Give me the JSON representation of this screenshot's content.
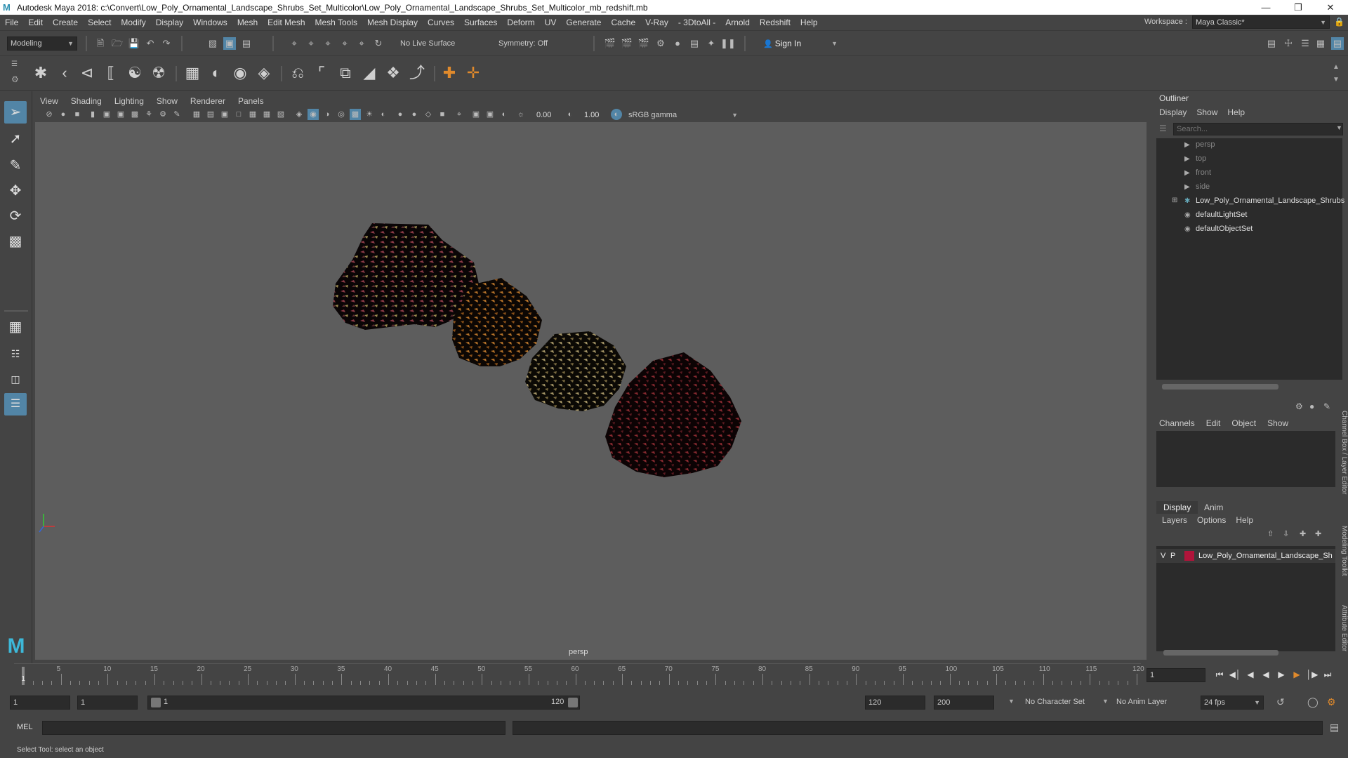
{
  "window": {
    "title": "Autodesk Maya 2018: c:\\Convert\\Low_Poly_Ornamental_Landscape_Shrubs_Set_Multicolor\\Low_Poly_Ornamental_Landscape_Shrubs_Set_Multicolor_mb_redshift.mb"
  },
  "menubar": {
    "items": [
      "File",
      "Edit",
      "Create",
      "Select",
      "Modify",
      "Display",
      "Windows",
      "Mesh",
      "Edit Mesh",
      "Mesh Tools",
      "Mesh Display",
      "Curves",
      "Surfaces",
      "Deform",
      "UV",
      "Generate",
      "Cache",
      "V-Ray",
      "- 3DtoAll -",
      "Arnold",
      "Redshift",
      "Help"
    ],
    "workspace_label": "Workspace :",
    "workspace_value": "Maya Classic*"
  },
  "statusline": {
    "mode": "Modeling",
    "live_surface": "No Live Surface",
    "symmetry": "Symmetry: Off",
    "sign_in": "Sign In"
  },
  "panel": {
    "menus": [
      "View",
      "Shading",
      "Lighting",
      "Show",
      "Renderer",
      "Panels"
    ],
    "exposure": "0.00",
    "gamma": "1.00",
    "color_space": "sRGB gamma",
    "camera": "persp"
  },
  "outliner": {
    "title": "Outliner",
    "menus": [
      "Display",
      "Show",
      "Help"
    ],
    "search_placeholder": "Search...",
    "items": [
      {
        "label": "persp",
        "icon": "camera-icon",
        "dim": true
      },
      {
        "label": "top",
        "icon": "camera-icon",
        "dim": true
      },
      {
        "label": "front",
        "icon": "camera-icon",
        "dim": true
      },
      {
        "label": "side",
        "icon": "camera-icon",
        "dim": true
      },
      {
        "label": "Low_Poly_Ornamental_Landscape_Shrubs",
        "icon": "group-icon",
        "dim": false
      },
      {
        "label": "defaultLightSet",
        "icon": "set-icon",
        "dim": false
      },
      {
        "label": "defaultObjectSet",
        "icon": "set-icon",
        "dim": false
      }
    ]
  },
  "channel_box": {
    "menus": [
      "Channels",
      "Edit",
      "Object",
      "Show"
    ]
  },
  "layer_editor": {
    "tabs": [
      "Display",
      "Anim"
    ],
    "menus": [
      "Layers",
      "Options",
      "Help"
    ],
    "layer": {
      "v": "V",
      "p": "P",
      "name": "Low_Poly_Ornamental_Landscape_Sh",
      "color": "#b0143a"
    }
  },
  "side_tabs": [
    "Channel Box / Layer Editor",
    "Modeling Toolkit",
    "Attribute Editor"
  ],
  "timeline": {
    "ticks": [
      5,
      10,
      15,
      20,
      25,
      30,
      35,
      40,
      45,
      50,
      55,
      60,
      65,
      70,
      75,
      80,
      85,
      90,
      95,
      100,
      105,
      110,
      115,
      120
    ],
    "current_label": "1",
    "current_frame": "1"
  },
  "range": {
    "start": "1",
    "anim_start": "1",
    "slider_start": "1",
    "slider_end": "120",
    "end": "120",
    "anim_end": "200",
    "character_set": "No Character Set",
    "anim_layer": "No Anim Layer",
    "fps": "24 fps"
  },
  "mel": {
    "label": "MEL"
  },
  "helpline": {
    "text": "Select Tool: select an object"
  },
  "colors": {
    "accent": "#5285a6",
    "viewport_bg": "#5d5d5d",
    "panel_bg": "#444444",
    "field_bg": "#2b2b2b"
  }
}
